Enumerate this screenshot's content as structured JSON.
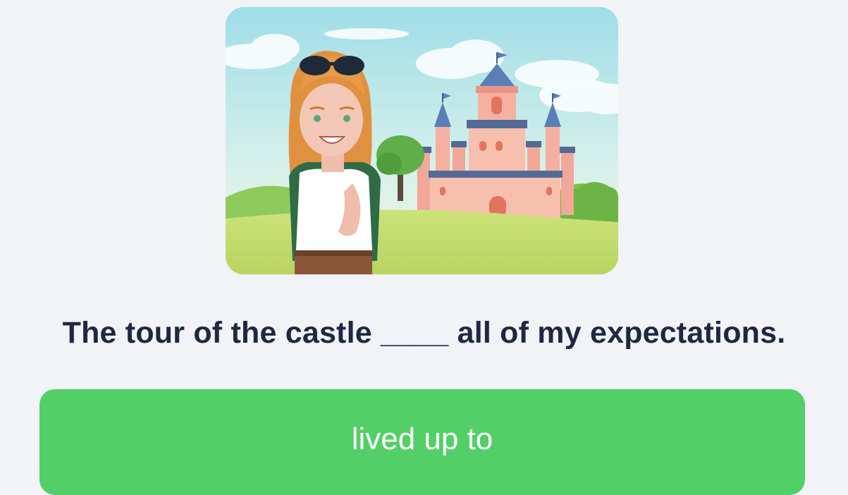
{
  "exercise": {
    "question": "The tour of the castle ____ all of my expectations.",
    "answer_option": "lived up to"
  },
  "colors": {
    "background": "#f1f3f6",
    "question_text": "#1f2840",
    "answer_button": "#52cf67",
    "answer_text": "#ffffff"
  },
  "illustration": {
    "subject": "traveler-with-sunglasses-in-front-of-castle"
  }
}
